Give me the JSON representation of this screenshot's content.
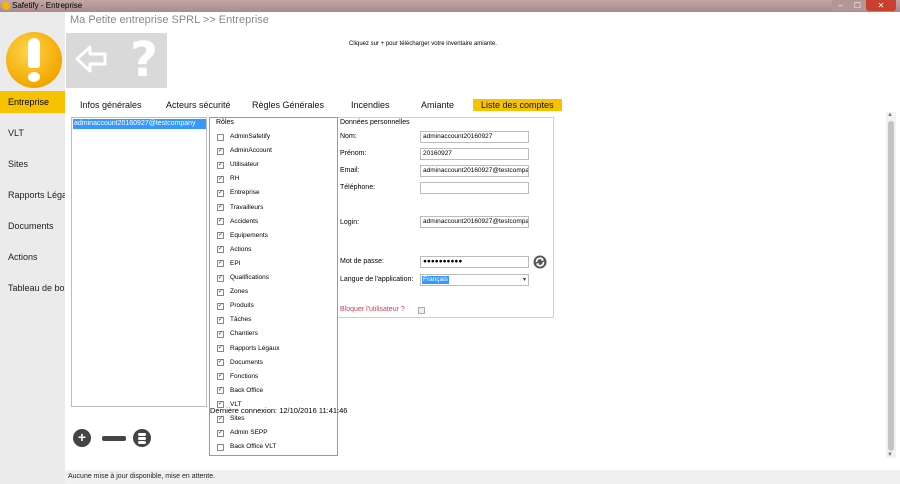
{
  "window": {
    "title": "Safetify - Entreprise",
    "min_glyph": "–",
    "max_glyph": "☐",
    "close_glyph": "✕"
  },
  "breadcrumb": "Ma Petite entreprise SPRL >> Entreprise",
  "info_note": "Cliquez sur + pour télécharger votre inventaire amiante.",
  "toolbox": {
    "help_glyph": "?"
  },
  "sidebar": {
    "items": [
      {
        "label": "Entreprise",
        "active": true
      },
      {
        "label": "VLT"
      },
      {
        "label": "Sites"
      },
      {
        "label": "Rapports Légaux"
      },
      {
        "label": "Documents"
      },
      {
        "label": "Actions"
      },
      {
        "label": "Tableau de bord"
      }
    ]
  },
  "tabs": [
    {
      "label": "Infos générales"
    },
    {
      "label": "Acteurs sécurité"
    },
    {
      "label": "Règles Générales"
    },
    {
      "label": "Incendies"
    },
    {
      "label": "Amiante"
    },
    {
      "label": "Liste des comptes",
      "active": true
    }
  ],
  "user_list": {
    "selected": "adminaccount20160927@testcompany"
  },
  "roles": {
    "title": "Rôles",
    "check_glyph": "✓",
    "items": [
      {
        "label": "AdminSafetify",
        "checked": false
      },
      {
        "label": "AdminAccount",
        "checked": true
      },
      {
        "label": "Utilisateur",
        "checked": true
      },
      {
        "label": "RH",
        "checked": true
      },
      {
        "label": "Entreprise",
        "checked": true
      },
      {
        "label": "Travailleurs",
        "checked": true
      },
      {
        "label": "Accidents",
        "checked": true
      },
      {
        "label": "Equipements",
        "checked": true
      },
      {
        "label": "Actions",
        "checked": true
      },
      {
        "label": "EPI",
        "checked": true
      },
      {
        "label": "Qualifications",
        "checked": true
      },
      {
        "label": "Zones",
        "checked": true
      },
      {
        "label": "Produits",
        "checked": true
      },
      {
        "label": "Tâches",
        "checked": true
      },
      {
        "label": "Chantiers",
        "checked": true
      },
      {
        "label": "Rapports Légaux",
        "checked": true
      },
      {
        "label": "Documents",
        "checked": true
      },
      {
        "label": "Fonctions",
        "checked": true
      },
      {
        "label": "Back Office",
        "checked": true
      },
      {
        "label": "VLT",
        "checked": true
      },
      {
        "label": "Sites",
        "checked": true
      },
      {
        "label": "Admin SEPP",
        "checked": true
      },
      {
        "label": "Back Office VLT",
        "checked": false
      }
    ]
  },
  "last_connection": "Dernière connexion: 12/10/2016 11:41:46",
  "personal": {
    "title": "Données personnelles",
    "nom_label": "Nom:",
    "nom_value": "adminaccount20160927",
    "prenom_label": "Prénom:",
    "prenom_value": "20160927",
    "email_label": "Email:",
    "email_value": "adminaccount20160927@testcompany",
    "telephone_label": "Téléphone:",
    "telephone_value": "",
    "login_label": "Login:",
    "login_value": "adminaccount20160927@testcompany",
    "password_label": "Mot de passe:",
    "password_value": "●●●●●●●●●●",
    "language_label": "Langue de l'application:",
    "language_value": "Français",
    "language_arrow": "▾",
    "block_label": "Bloquer l'utilisateur ?"
  },
  "actions": {
    "add_glyph": "+"
  },
  "scroll": {
    "up_glyph": "▲",
    "down_glyph": "▼"
  },
  "status": "Aucune mise à jour disponible, mise en attente.",
  "colors": {
    "accent": "#f7c300",
    "roles_border": "#6fbf4a",
    "selection": "#3399ff",
    "block_text": "#d04050"
  }
}
